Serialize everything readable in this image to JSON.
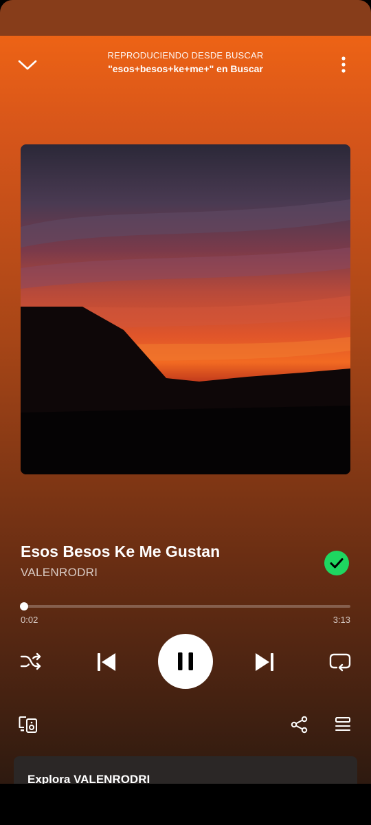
{
  "header": {
    "context_label": "REPRODUCIENDO DESDE BUSCAR",
    "source_label": "\"esos+besos+ke+me+\" en Buscar"
  },
  "track": {
    "title": "Esos Besos Ke Me Gustan",
    "artist": "VALENRODRI",
    "liked": true
  },
  "playback": {
    "elapsed": "0:02",
    "duration": "3:13",
    "progress_fraction": 0.0104,
    "state": "playing"
  },
  "controls": {
    "icons": [
      "shuffle-icon",
      "previous-icon",
      "pause-icon",
      "next-icon",
      "repeat-icon"
    ]
  },
  "footer_actions": {
    "icons": [
      "devices-icon",
      "share-icon",
      "queue-icon"
    ]
  },
  "explore": {
    "title": "Explora VALENRODRI"
  },
  "colors": {
    "accent_green": "#1ed760",
    "gradient_top": "#ed6315",
    "gradient_bottom": "#2e1a10",
    "card_bg": "#2b2726"
  }
}
